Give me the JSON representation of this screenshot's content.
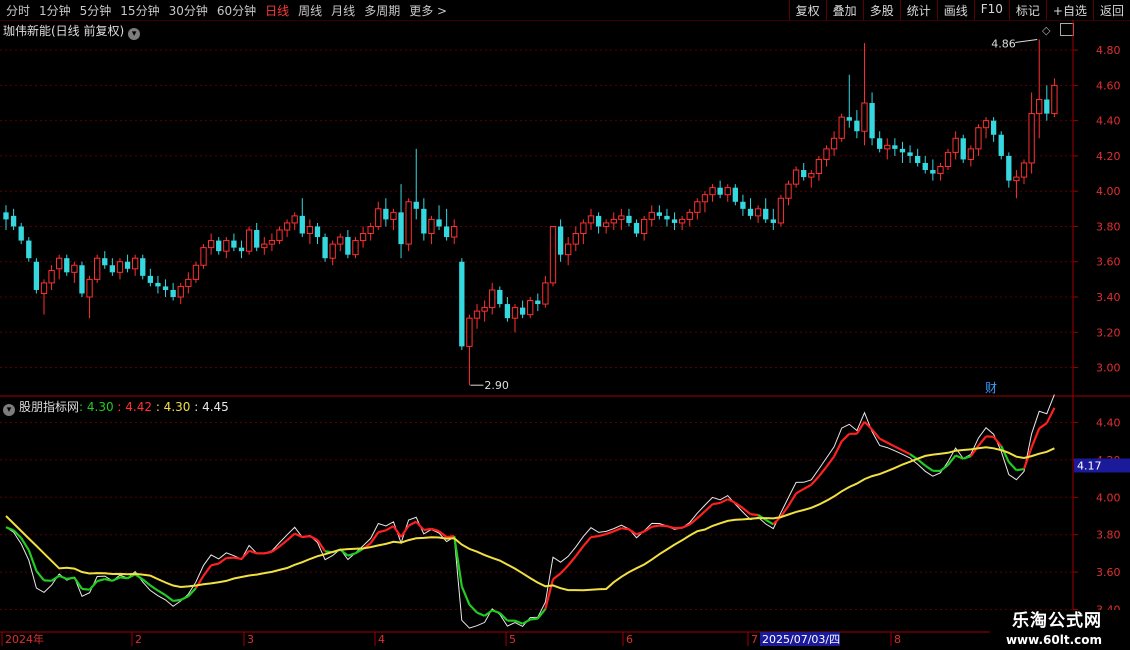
{
  "toolbar": {
    "periods": [
      "分时",
      "1分钟",
      "5分钟",
      "15分钟",
      "30分钟",
      "60分钟",
      "日线",
      "周线",
      "月线",
      "多周期",
      "更多 >"
    ],
    "active_period": "日线",
    "tools": [
      "复权",
      "叠加",
      "多股",
      "统计",
      "画线",
      "F10",
      "标记",
      "+自选",
      "返回"
    ]
  },
  "stock": {
    "title": "珈伟新能(日线 前复权)"
  },
  "indicator": {
    "name": "股朋指标网",
    "v1": ": 4.30",
    "v2": ": 4.42",
    "v3": ": 4.30",
    "v4": ": 4.45"
  },
  "colors": {
    "up": "#ff3030",
    "down": "#36d8e0",
    "grid": "#5a0000",
    "green": "#22cc22",
    "red": "#ff2020",
    "yellow": "#f0e040",
    "white": "#e8e8e8"
  },
  "chart_data": [
    {
      "type": "candlestick",
      "ylim": [
        2.85,
        4.88
      ],
      "yticks": [
        "4.80",
        "4.60",
        "4.40",
        "4.20",
        "4.00",
        "3.80",
        "3.60",
        "3.40",
        "3.20",
        "3.00"
      ],
      "annotations": {
        "high_label": "4.86",
        "low_label": "2.90",
        "event_label": "财"
      },
      "ohlc": [
        [
          3.88,
          3.92,
          3.78,
          3.84
        ],
        [
          3.86,
          3.9,
          3.78,
          3.8
        ],
        [
          3.8,
          3.82,
          3.7,
          3.72
        ],
        [
          3.72,
          3.74,
          3.6,
          3.62
        ],
        [
          3.6,
          3.62,
          3.42,
          3.44
        ],
        [
          3.42,
          3.5,
          3.3,
          3.48
        ],
        [
          3.48,
          3.58,
          3.44,
          3.55
        ],
        [
          3.56,
          3.64,
          3.5,
          3.62
        ],
        [
          3.62,
          3.64,
          3.52,
          3.54
        ],
        [
          3.54,
          3.6,
          3.48,
          3.58
        ],
        [
          3.58,
          3.6,
          3.4,
          3.42
        ],
        [
          3.4,
          3.52,
          3.28,
          3.5
        ],
        [
          3.5,
          3.64,
          3.48,
          3.62
        ],
        [
          3.62,
          3.66,
          3.56,
          3.58
        ],
        [
          3.58,
          3.62,
          3.52,
          3.54
        ],
        [
          3.54,
          3.62,
          3.5,
          3.6
        ],
        [
          3.6,
          3.64,
          3.54,
          3.56
        ],
        [
          3.56,
          3.64,
          3.52,
          3.62
        ],
        [
          3.62,
          3.64,
          3.5,
          3.52
        ],
        [
          3.52,
          3.56,
          3.46,
          3.48
        ],
        [
          3.48,
          3.52,
          3.42,
          3.46
        ],
        [
          3.46,
          3.5,
          3.4,
          3.44
        ],
        [
          3.44,
          3.48,
          3.38,
          3.4
        ],
        [
          3.4,
          3.48,
          3.36,
          3.46
        ],
        [
          3.46,
          3.54,
          3.42,
          3.5
        ],
        [
          3.5,
          3.6,
          3.48,
          3.58
        ],
        [
          3.58,
          3.7,
          3.56,
          3.68
        ],
        [
          3.68,
          3.76,
          3.64,
          3.72
        ],
        [
          3.72,
          3.74,
          3.64,
          3.66
        ],
        [
          3.66,
          3.74,
          3.62,
          3.72
        ],
        [
          3.72,
          3.76,
          3.66,
          3.68
        ],
        [
          3.68,
          3.72,
          3.62,
          3.66
        ],
        [
          3.66,
          3.8,
          3.64,
          3.78
        ],
        [
          3.78,
          3.82,
          3.66,
          3.68
        ],
        [
          3.68,
          3.74,
          3.64,
          3.7
        ],
        [
          3.7,
          3.76,
          3.66,
          3.72
        ],
        [
          3.72,
          3.8,
          3.7,
          3.78
        ],
        [
          3.78,
          3.84,
          3.74,
          3.82
        ],
        [
          3.82,
          3.88,
          3.78,
          3.86
        ],
        [
          3.86,
          3.96,
          3.74,
          3.76
        ],
        [
          3.76,
          3.84,
          3.7,
          3.8
        ],
        [
          3.8,
          3.82,
          3.7,
          3.74
        ],
        [
          3.74,
          3.76,
          3.6,
          3.62
        ],
        [
          3.62,
          3.72,
          3.58,
          3.7
        ],
        [
          3.7,
          3.76,
          3.66,
          3.74
        ],
        [
          3.74,
          3.78,
          3.62,
          3.64
        ],
        [
          3.64,
          3.74,
          3.62,
          3.72
        ],
        [
          3.72,
          3.8,
          3.68,
          3.76
        ],
        [
          3.76,
          3.82,
          3.72,
          3.8
        ],
        [
          3.8,
          3.94,
          3.78,
          3.9
        ],
        [
          3.9,
          3.96,
          3.8,
          3.84
        ],
        [
          3.84,
          3.9,
          3.78,
          3.88
        ],
        [
          3.88,
          4.04,
          3.62,
          3.7
        ],
        [
          3.7,
          3.96,
          3.66,
          3.94
        ],
        [
          3.94,
          4.24,
          3.84,
          3.9
        ],
        [
          3.9,
          3.96,
          3.72,
          3.76
        ],
        [
          3.76,
          3.86,
          3.7,
          3.84
        ],
        [
          3.84,
          3.92,
          3.78,
          3.8
        ],
        [
          3.8,
          3.9,
          3.72,
          3.74
        ],
        [
          3.74,
          3.84,
          3.7,
          3.8
        ],
        [
          3.6,
          3.62,
          3.1,
          3.12
        ],
        [
          3.12,
          3.3,
          2.9,
          3.28
        ],
        [
          3.28,
          3.36,
          3.22,
          3.32
        ],
        [
          3.32,
          3.38,
          3.26,
          3.34
        ],
        [
          3.34,
          3.48,
          3.3,
          3.44
        ],
        [
          3.44,
          3.46,
          3.34,
          3.36
        ],
        [
          3.36,
          3.4,
          3.26,
          3.28
        ],
        [
          3.28,
          3.36,
          3.2,
          3.34
        ],
        [
          3.34,
          3.38,
          3.28,
          3.3
        ],
        [
          3.3,
          3.4,
          3.28,
          3.38
        ],
        [
          3.38,
          3.42,
          3.32,
          3.36
        ],
        [
          3.36,
          3.52,
          3.34,
          3.48
        ],
        [
          3.48,
          3.68,
          3.46,
          3.8
        ],
        [
          3.8,
          3.84,
          3.6,
          3.64
        ],
        [
          3.64,
          3.74,
          3.58,
          3.7
        ],
        [
          3.7,
          3.8,
          3.66,
          3.76
        ],
        [
          3.76,
          3.84,
          3.7,
          3.82
        ],
        [
          3.82,
          3.9,
          3.78,
          3.86
        ],
        [
          3.86,
          3.88,
          3.76,
          3.8
        ],
        [
          3.8,
          3.84,
          3.76,
          3.82
        ],
        [
          3.82,
          3.88,
          3.78,
          3.84
        ],
        [
          3.84,
          3.9,
          3.78,
          3.86
        ],
        [
          3.86,
          3.9,
          3.8,
          3.82
        ],
        [
          3.82,
          3.84,
          3.74,
          3.76
        ],
        [
          3.76,
          3.86,
          3.72,
          3.84
        ],
        [
          3.84,
          3.92,
          3.8,
          3.88
        ],
        [
          3.88,
          3.92,
          3.84,
          3.86
        ],
        [
          3.86,
          3.9,
          3.8,
          3.84
        ],
        [
          3.84,
          3.88,
          3.78,
          3.82
        ],
        [
          3.82,
          3.86,
          3.78,
          3.84
        ],
        [
          3.84,
          3.9,
          3.8,
          3.88
        ],
        [
          3.88,
          3.96,
          3.84,
          3.94
        ],
        [
          3.94,
          4.0,
          3.88,
          3.98
        ],
        [
          3.98,
          4.04,
          3.94,
          4.02
        ],
        [
          4.02,
          4.06,
          3.96,
          3.98
        ],
        [
          3.98,
          4.04,
          3.94,
          4.02
        ],
        [
          4.02,
          4.04,
          3.92,
          3.94
        ],
        [
          3.94,
          3.98,
          3.86,
          3.9
        ],
        [
          3.9,
          3.96,
          3.84,
          3.86
        ],
        [
          3.86,
          3.92,
          3.82,
          3.9
        ],
        [
          3.9,
          3.96,
          3.82,
          3.84
        ],
        [
          3.84,
          3.9,
          3.78,
          3.82
        ],
        [
          3.82,
          3.98,
          3.8,
          3.96
        ],
        [
          3.96,
          4.06,
          3.92,
          4.04
        ],
        [
          4.04,
          4.14,
          4.02,
          4.12
        ],
        [
          4.12,
          4.16,
          4.06,
          4.08
        ],
        [
          4.08,
          4.12,
          4.02,
          4.1
        ],
        [
          4.1,
          4.2,
          4.06,
          4.18
        ],
        [
          4.18,
          4.26,
          4.14,
          4.24
        ],
        [
          4.24,
          4.34,
          4.2,
          4.3
        ],
        [
          4.3,
          4.44,
          4.28,
          4.42
        ],
        [
          4.42,
          4.66,
          4.36,
          4.4
        ],
        [
          4.4,
          4.46,
          4.3,
          4.34
        ],
        [
          4.34,
          4.84,
          4.26,
          4.5
        ],
        [
          4.5,
          4.56,
          4.26,
          4.3
        ],
        [
          4.3,
          4.34,
          4.22,
          4.24
        ],
        [
          4.24,
          4.3,
          4.18,
          4.26
        ],
        [
          4.26,
          4.3,
          4.2,
          4.24
        ],
        [
          4.24,
          4.28,
          4.16,
          4.22
        ],
        [
          4.22,
          4.26,
          4.16,
          4.2
        ],
        [
          4.2,
          4.24,
          4.14,
          4.16
        ],
        [
          4.16,
          4.2,
          4.1,
          4.12
        ],
        [
          4.12,
          4.18,
          4.06,
          4.1
        ],
        [
          4.1,
          4.16,
          4.06,
          4.14
        ],
        [
          4.14,
          4.24,
          4.12,
          4.22
        ],
        [
          4.22,
          4.34,
          4.18,
          4.3
        ],
        [
          4.3,
          4.32,
          4.16,
          4.18
        ],
        [
          4.18,
          4.26,
          4.14,
          4.24
        ],
        [
          4.24,
          4.38,
          4.2,
          4.36
        ],
        [
          4.36,
          4.42,
          4.3,
          4.4
        ],
        [
          4.4,
          4.42,
          4.28,
          4.32
        ],
        [
          4.32,
          4.34,
          4.18,
          4.2
        ],
        [
          4.2,
          4.22,
          4.02,
          4.06
        ],
        [
          4.06,
          4.12,
          3.96,
          4.08
        ],
        [
          4.08,
          4.18,
          4.04,
          4.16
        ],
        [
          4.16,
          4.56,
          4.1,
          4.44
        ],
        [
          4.44,
          4.86,
          4.3,
          4.52
        ],
        [
          4.52,
          4.6,
          4.4,
          4.44
        ],
        [
          4.44,
          4.64,
          4.42,
          4.6
        ]
      ]
    },
    {
      "type": "line",
      "title": "股朋指标网",
      "ylim": [
        3.28,
        4.52
      ],
      "yticks": [
        "4.40",
        "4.20",
        "4.00",
        "3.80",
        "3.60",
        "3.40"
      ],
      "current_value_label": "4.17",
      "xlabels": [
        "2024年",
        "2",
        "3",
        "4",
        "5",
        "6",
        "7",
        "8"
      ],
      "date_label": "2025/07/03/四"
    }
  ],
  "watermark": {
    "line1": "乐淘公式网",
    "line2": "www.60lt.com"
  }
}
